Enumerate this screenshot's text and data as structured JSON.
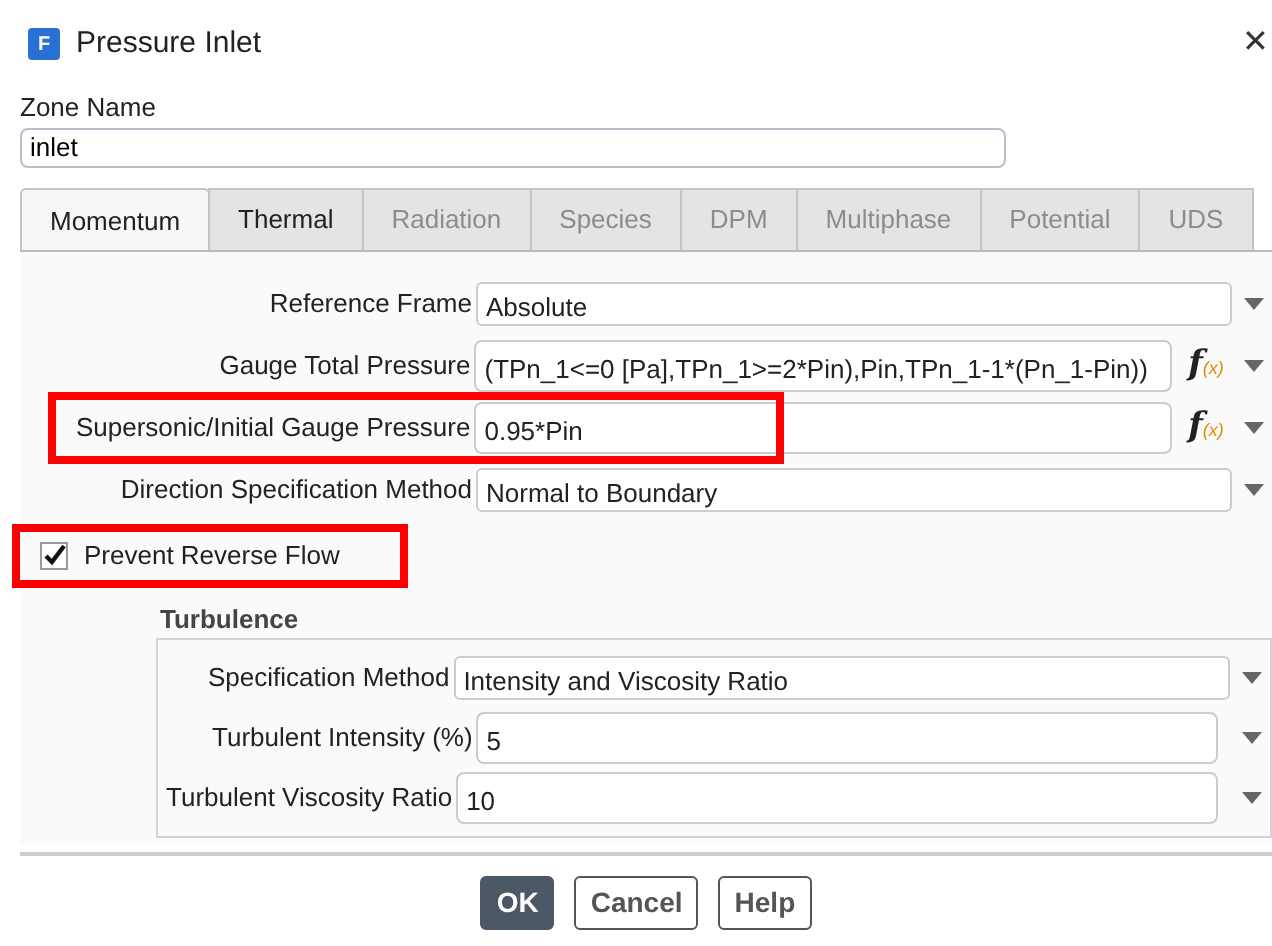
{
  "window": {
    "app_icon": "F",
    "title": "Pressure Inlet",
    "close": "✕"
  },
  "zone": {
    "label": "Zone Name",
    "value": "inlet"
  },
  "tabs": [
    {
      "label": "Momentum",
      "selected": true,
      "disabled": false
    },
    {
      "label": "Thermal",
      "selected": false,
      "disabled": false
    },
    {
      "label": "Radiation",
      "selected": false,
      "disabled": true
    },
    {
      "label": "Species",
      "selected": false,
      "disabled": true
    },
    {
      "label": "DPM",
      "selected": false,
      "disabled": true
    },
    {
      "label": "Multiphase",
      "selected": false,
      "disabled": true
    },
    {
      "label": "Potential",
      "selected": false,
      "disabled": true
    },
    {
      "label": "UDS",
      "selected": false,
      "disabled": true
    }
  ],
  "fields": [
    {
      "kind": "select",
      "label": "Reference Frame",
      "value": "Absolute",
      "highlighted": false
    },
    {
      "kind": "expression",
      "label": "Gauge Total Pressure",
      "value": "(TPn_1<=0 [Pa],TPn_1>=2*Pin),Pin,TPn_1-1*(Pn_1-Pin))",
      "function_icon": {
        "main": "f",
        "sub": "(x)"
      },
      "highlighted": false
    },
    {
      "kind": "expression",
      "label": "Supersonic/Initial Gauge Pressure",
      "value": "0.95*Pin",
      "function_icon": {
        "main": "f",
        "sub": "(x)"
      },
      "highlighted": true
    },
    {
      "kind": "select",
      "label": "Direction Specification Method",
      "value": "Normal to Boundary",
      "highlighted": false
    },
    {
      "kind": "checkbox",
      "label": "Prevent Reverse Flow",
      "checked": true,
      "highlighted": true
    }
  ],
  "turbulence": {
    "title": "Turbulence",
    "fields": [
      {
        "kind": "select",
        "label": "Specification Method",
        "value": "Intensity and Viscosity Ratio"
      },
      {
        "kind": "number",
        "label": "Turbulent Intensity (%)",
        "value": "5"
      },
      {
        "kind": "number",
        "label": "Turbulent Viscosity Ratio",
        "value": "10"
      }
    ]
  },
  "buttons": [
    {
      "label": "OK",
      "primary": true
    },
    {
      "label": "Cancel",
      "primary": false
    },
    {
      "label": "Help",
      "primary": false
    }
  ]
}
